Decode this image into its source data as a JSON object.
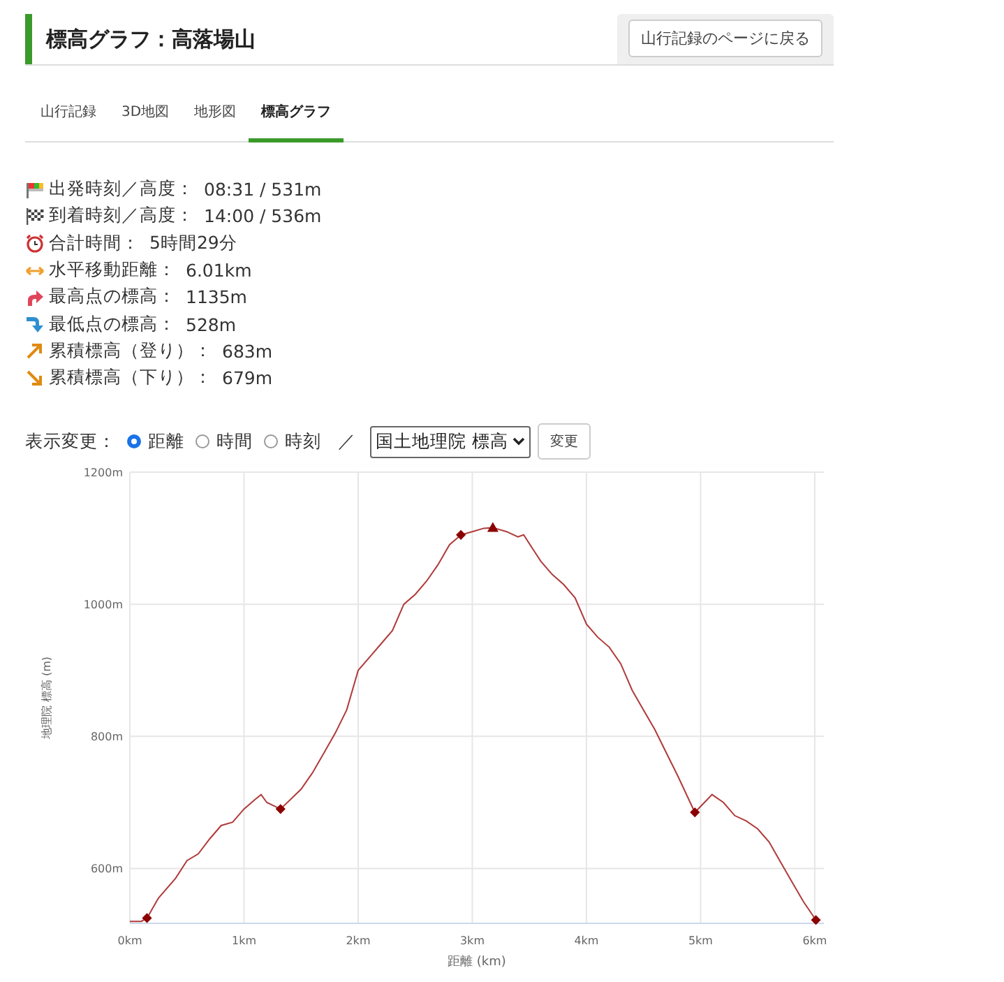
{
  "header": {
    "title": "標高グラフ：高落場山",
    "back_button": "山行記録のページに戻る"
  },
  "tabs": [
    {
      "label": "山行記録",
      "selected": false
    },
    {
      "label": "3D地図",
      "selected": false
    },
    {
      "label": "地形図",
      "selected": false
    },
    {
      "label": "標高グラフ",
      "selected": true
    }
  ],
  "stats": [
    {
      "kind": "start",
      "label": "出発時刻／高度：",
      "value": "08:31 / 531m"
    },
    {
      "kind": "goal",
      "label": "到着時刻／高度：",
      "value": "14:00 / 536m"
    },
    {
      "kind": "clock",
      "label": "合計時間：",
      "value": "5時間29分"
    },
    {
      "kind": "distance",
      "label": "水平移動距離：",
      "value": "6.01km"
    },
    {
      "kind": "highest",
      "label": "最高点の標高：",
      "value": "1135m"
    },
    {
      "kind": "lowest",
      "label": "最低点の標高：",
      "value": "528m"
    },
    {
      "kind": "ascent",
      "label": "累積標高（登り）：",
      "value": "683m"
    },
    {
      "kind": "descent",
      "label": "累積標高（下り）：",
      "value": "679m"
    }
  ],
  "display": {
    "label": "表示変更：",
    "options": [
      {
        "label": "距離",
        "selected": true
      },
      {
        "label": "時間",
        "selected": false
      },
      {
        "label": "時刻",
        "selected": false
      }
    ],
    "separator": "／",
    "source_select": "国土地理院 標高",
    "apply_button": "変更"
  },
  "chart": {
    "chart_data": {
      "type": "line",
      "xlabel": "距離 (km)",
      "ylabel": "地理院 標高 (m)",
      "x": [
        0,
        0.1,
        0.15,
        0.25,
        0.4,
        0.5,
        0.6,
        0.7,
        0.8,
        0.9,
        1.0,
        1.1,
        1.15,
        1.2,
        1.32,
        1.5,
        1.6,
        1.7,
        1.8,
        1.9,
        2.0,
        2.1,
        2.2,
        2.3,
        2.4,
        2.5,
        2.6,
        2.7,
        2.8,
        2.9,
        3.0,
        3.1,
        3.18,
        3.3,
        3.4,
        3.45,
        3.6,
        3.7,
        3.8,
        3.9,
        4.0,
        4.1,
        4.2,
        4.3,
        4.4,
        4.5,
        4.6,
        4.7,
        4.8,
        4.95,
        5.1,
        5.2,
        5.3,
        5.4,
        5.5,
        5.6,
        5.7,
        5.8,
        5.9,
        6.01
      ],
      "series": [
        {
          "color": "#b03a3a",
          "values": [
            520,
            520,
            525,
            555,
            585,
            612,
            622,
            645,
            665,
            670,
            690,
            705,
            712,
            700,
            690,
            720,
            745,
            775,
            805,
            840,
            900,
            920,
            940,
            960,
            1000,
            1015,
            1035,
            1060,
            1090,
            1105,
            1110,
            1115,
            1116,
            1110,
            1102,
            1105,
            1065,
            1045,
            1030,
            1010,
            970,
            950,
            935,
            910,
            870,
            840,
            810,
            775,
            740,
            685,
            712,
            700,
            680,
            672,
            660,
            640,
            610,
            580,
            550,
            522
          ]
        },
        {
          "color": "#8b0000",
          "marker": "diamond",
          "values": [
            null,
            null,
            525,
            null,
            null,
            null,
            null,
            null,
            null,
            null,
            null,
            null,
            null,
            null,
            null,
            null,
            null,
            null,
            null,
            null,
            null,
            null,
            null,
            null,
            null,
            null,
            null,
            null,
            null,
            null,
            null,
            null,
            null,
            null,
            null,
            null,
            null,
            null,
            null,
            null,
            null,
            null,
            null,
            null,
            null,
            null,
            null,
            null,
            null,
            null,
            null,
            null,
            null,
            null,
            null,
            null,
            null,
            null,
            null,
            null
          ]
        },
        {
          "color": "#8b0000",
          "marker": "diamond",
          "values": [
            null,
            null,
            null,
            null,
            null,
            null,
            null,
            null,
            null,
            null,
            null,
            null,
            null,
            null,
            690,
            null,
            null,
            null,
            null,
            null,
            null,
            null,
            null,
            null,
            null,
            null,
            null,
            null,
            null,
            null,
            null,
            null,
            null,
            null,
            null,
            null,
            null,
            null,
            null,
            null,
            null,
            null,
            null,
            null,
            null,
            null,
            null,
            null,
            null,
            null,
            null,
            null,
            null,
            null,
            null,
            null,
            null,
            null,
            null,
            null
          ]
        },
        {
          "color": "#8b0000",
          "marker": "diamond",
          "values": [
            null,
            null,
            null,
            null,
            null,
            null,
            null,
            null,
            null,
            null,
            null,
            null,
            null,
            null,
            null,
            null,
            null,
            null,
            null,
            null,
            null,
            null,
            null,
            null,
            null,
            null,
            null,
            null,
            null,
            1105,
            null,
            null,
            null,
            null,
            null,
            null,
            null,
            null,
            null,
            null,
            null,
            null,
            null,
            null,
            null,
            null,
            null,
            null,
            null,
            null,
            null,
            null,
            null,
            null,
            null,
            null,
            null,
            null,
            null,
            null
          ]
        },
        {
          "color": "#8b0000",
          "marker": "diamond",
          "values": [
            null,
            null,
            null,
            null,
            null,
            null,
            null,
            null,
            null,
            null,
            null,
            null,
            null,
            null,
            null,
            null,
            null,
            null,
            null,
            null,
            null,
            null,
            null,
            null,
            null,
            null,
            null,
            null,
            null,
            null,
            null,
            null,
            null,
            null,
            null,
            null,
            null,
            null,
            null,
            null,
            null,
            null,
            null,
            null,
            null,
            null,
            null,
            null,
            null,
            685,
            null,
            null,
            null,
            null,
            null,
            null,
            null,
            null,
            null,
            null
          ]
        },
        {
          "color": "#8b0000",
          "marker": "diamond",
          "values": [
            null,
            null,
            null,
            null,
            null,
            null,
            null,
            null,
            null,
            null,
            null,
            null,
            null,
            null,
            null,
            null,
            null,
            null,
            null,
            null,
            null,
            null,
            null,
            null,
            null,
            null,
            null,
            null,
            null,
            null,
            null,
            null,
            null,
            null,
            null,
            null,
            null,
            null,
            null,
            null,
            null,
            null,
            null,
            null,
            null,
            null,
            null,
            null,
            null,
            null,
            null,
            null,
            null,
            null,
            null,
            null,
            null,
            null,
            null,
            522
          ]
        },
        {
          "color": "#8b0000",
          "marker": "triangle",
          "values": [
            null,
            null,
            null,
            null,
            null,
            null,
            null,
            null,
            null,
            null,
            null,
            null,
            null,
            null,
            null,
            null,
            null,
            null,
            null,
            null,
            null,
            null,
            null,
            null,
            null,
            null,
            null,
            null,
            null,
            null,
            null,
            null,
            1116,
            null,
            null,
            null,
            null,
            null,
            null,
            null,
            null,
            null,
            null,
            null,
            null,
            null,
            null,
            null,
            null,
            null,
            null,
            null,
            null,
            null,
            null,
            null,
            null,
            null,
            null,
            null
          ]
        }
      ],
      "grid": true,
      "xlim": [
        0,
        6.08
      ],
      "ylim": [
        517,
        1200
      ],
      "xticks": [
        {
          "value": 0,
          "label": "0km"
        },
        {
          "value": 1,
          "label": "1km"
        },
        {
          "value": 2,
          "label": "2km"
        },
        {
          "value": 3,
          "label": "3km"
        },
        {
          "value": 4,
          "label": "4km"
        },
        {
          "value": 5,
          "label": "5km"
        },
        {
          "value": 6,
          "label": "6km"
        }
      ],
      "yticks": [
        {
          "value": 600,
          "label": "600m"
        },
        {
          "value": 800,
          "label": "800m"
        },
        {
          "value": 1000,
          "label": "1000m"
        },
        {
          "value": 1200,
          "label": "1200m"
        }
      ]
    }
  }
}
